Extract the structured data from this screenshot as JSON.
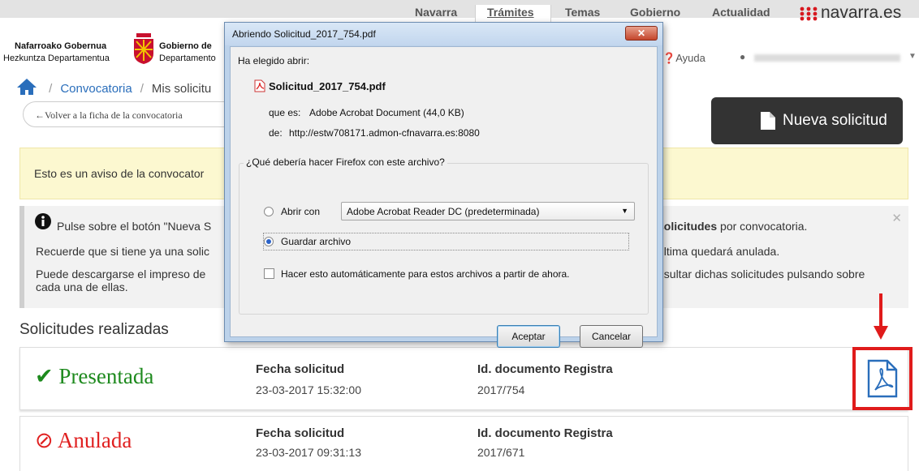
{
  "topnav": {
    "items": [
      "Navarra",
      "Trámites",
      "Temas",
      "Gobierno",
      "Actualidad"
    ],
    "brand": "navarra.es",
    "help": "Ayuda"
  },
  "header": {
    "org_line1_left": "Nafarroako Gobernua",
    "org_line2_left": "Hezkuntza Departamentua",
    "org_line1_right": "Gobierno de",
    "org_line2_right": "Departamento"
  },
  "breadcrumb": [
    "Convocatoria",
    "Mis solicitu"
  ],
  "back_button": "←Volver a la ficha de la convocatoria",
  "new_button": "Nueva solicitud",
  "notice": "Esto es un aviso de la convocator",
  "info": {
    "line1_left": "Pulse sobre el botón \"Nueva S",
    "line1_right_bold": "solicitudes",
    "line1_right": " por convocatoria.",
    "line2_left": "Recuerde que si tiene ya una solic",
    "line2_right": "última quedará anulada.",
    "line3_left": "Puede descargarse el impreso de",
    "line3_right": "nsultar dichas solicitudes pulsando sobre",
    "line4": "cada una de ellas."
  },
  "section_title": "Solicitudes realizadas",
  "solicitudes": [
    {
      "status": "Presentada",
      "date_label": "Fecha solicitud",
      "date": "23-03-2017 15:32:00",
      "doc_label": "Id. documento Registra",
      "doc": "2017/754"
    },
    {
      "status": "Anulada",
      "date_label": "Fecha solicitud",
      "date": "23-03-2017 09:31:13",
      "doc_label": "Id. documento Registra",
      "doc": "2017/671"
    }
  ],
  "dialog": {
    "title": "Abriendo Solicitud_2017_754.pdf",
    "chosen": "Ha elegido abrir:",
    "filename": "Solicitud_2017_754.pdf",
    "type_label": "que es:",
    "type_value": "Adobe Acrobat Document (44,0 KB)",
    "from_label": "de:",
    "from_value": "http://estw708171.admon-cfnavarra.es:8080",
    "question": "¿Qué debería hacer Firefox con este archivo?",
    "open_with": "Abrir con",
    "app": "Adobe Acrobat Reader DC  (predeterminada)",
    "save": "Guardar archivo",
    "auto": "Hacer esto automáticamente para estos archivos a partir de ahora.",
    "ok": "Aceptar",
    "cancel": "Cancelar"
  },
  "colors": {
    "green": "#1e8a1e",
    "red": "#e02020",
    "accent_blue": "#2a6ebb",
    "highlight": "#e01b1b"
  }
}
